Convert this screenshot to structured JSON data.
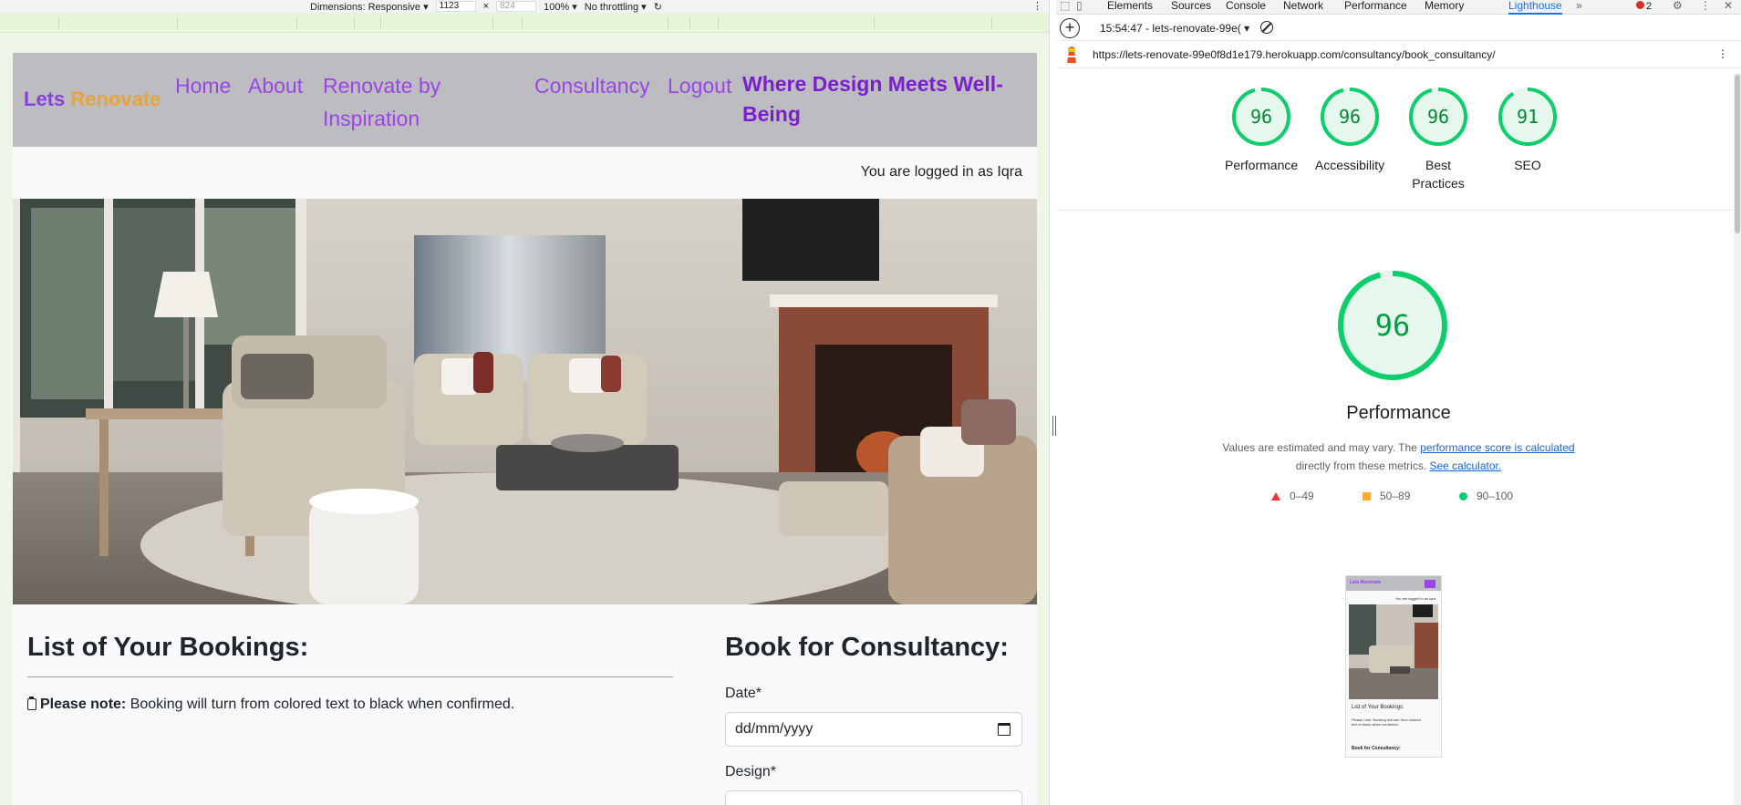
{
  "device_toolbar": {
    "dimensions_label": "Dimensions: Responsive ▾",
    "width_value": "1123",
    "times": "×",
    "height_placeholder": "824",
    "zoom": "100% ▾",
    "throttling": "No throttling ▾"
  },
  "site": {
    "logo_part1": "Lets",
    "logo_part2": "Renovate",
    "nav": {
      "home": "Home",
      "about": "About",
      "renovate": "Renovate by Inspiration",
      "consultancy": "Consultancy",
      "logout": "Logout"
    },
    "tagline_line1": "Where Design Meets Well-",
    "tagline_line2": "Being",
    "logged_in": "You are logged in as Iqra",
    "bookings_title": "List of Your Bookings:",
    "note_bold": "Please note:",
    "note_text": " Booking will turn from colored text to black when confirmed.",
    "book_title": "Book for Consultancy:",
    "date_label": "Date*",
    "date_placeholder": "dd/mm/yyyy",
    "design_label": "Design*"
  },
  "devtools": {
    "tabs": [
      "Elements",
      "Sources",
      "Console",
      "Network",
      "Performance",
      "Memory",
      "Lighthouse"
    ],
    "active_tab": "Lighthouse",
    "more_tabs": "»",
    "error_count": "2",
    "report_label": "15:54:47 - lets-renovate-99e(",
    "report_dropdown": "▾",
    "url": "https://lets-renovate-99e0f8d1e179.herokuapp.com/consultancy/book_consultancy/",
    "scores": [
      {
        "name": "Performance",
        "value": "96"
      },
      {
        "name": "Accessibility",
        "value": "96"
      },
      {
        "name": "Best Practices",
        "value": "96"
      },
      {
        "name": "SEO",
        "value": "91"
      }
    ],
    "main_score": "96",
    "main_title": "Performance",
    "desc_1": "Values are estimated and may vary. The ",
    "desc_link1": "performance score is calculated",
    "desc_2": "directly from these metrics. ",
    "desc_link2": "See calculator.",
    "legend": {
      "low": "0–49",
      "mid": "50–89",
      "high": "90–100"
    },
    "thumb": {
      "logo": "Lets Renovate",
      "login": "You are logged in as Iqra",
      "title": "List of Your Bookings:",
      "note": "Please note: Booking will turn from colored text to black when confirmed.",
      "book": "Book for Consultancy:"
    }
  },
  "colors": {
    "accent_purple": "#9a45e6",
    "logo_orange": "#e8a33a",
    "score_green": "#0cce6b",
    "lighthouse_blue": "#1a73e8"
  }
}
